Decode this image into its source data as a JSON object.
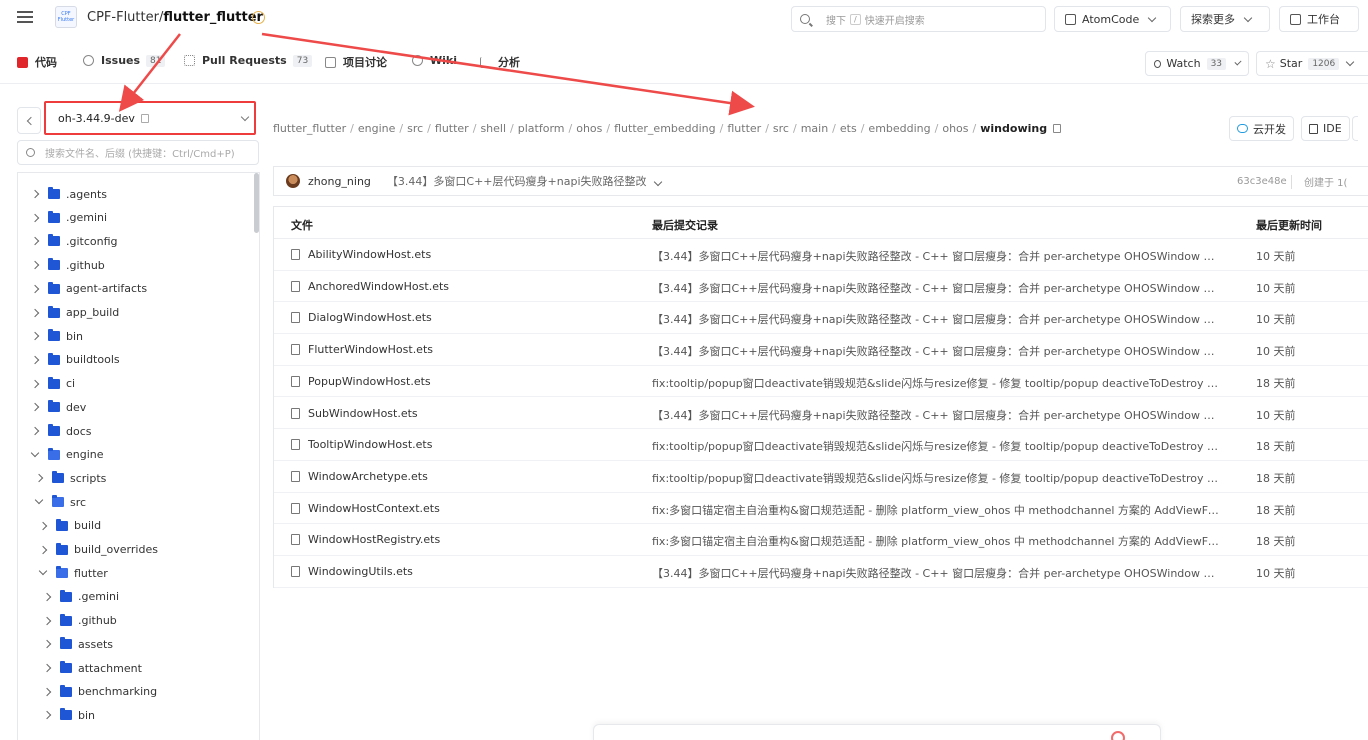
{
  "header": {
    "repo_owner": "CPF-Flutter/",
    "repo_name": "flutter_flutter",
    "logo_text": "CPF Flutter",
    "search": {
      "placeholder_prefix": "搜下",
      "shortcut": "/",
      "placeholder_suffix": "快速开启搜索"
    },
    "atomcode_label": "AtomCode",
    "explore_label": "探索更多",
    "workbench_label": "工作台"
  },
  "tabs": {
    "code": "代码",
    "issues": "Issues",
    "issues_count": "81",
    "pull_requests": "Pull Requests",
    "pull_requests_count": "73",
    "discussion": "项目讨论",
    "wiki": "Wiki",
    "analysis": "分析",
    "watch": "Watch",
    "watch_count": "33",
    "star": "Star",
    "star_count": "1206"
  },
  "sidebar": {
    "branch": "oh-3.44.9-dev",
    "file_search_placeholder": "搜索文件名、后缀 (快捷键：Ctrl/Cmd+P)",
    "tree": [
      {
        "label": ".agents",
        "level": 0,
        "open": false
      },
      {
        "label": ".gemini",
        "level": 0,
        "open": false
      },
      {
        "label": ".gitconfig",
        "level": 0,
        "open": false
      },
      {
        "label": ".github",
        "level": 0,
        "open": false
      },
      {
        "label": "agent-artifacts",
        "level": 0,
        "open": false
      },
      {
        "label": "app_build",
        "level": 0,
        "open": false
      },
      {
        "label": "bin",
        "level": 0,
        "open": false
      },
      {
        "label": "buildtools",
        "level": 0,
        "open": false
      },
      {
        "label": "ci",
        "level": 0,
        "open": false
      },
      {
        "label": "dev",
        "level": 0,
        "open": false
      },
      {
        "label": "docs",
        "level": 0,
        "open": false
      },
      {
        "label": "engine",
        "level": 0,
        "open": true
      },
      {
        "label": "scripts",
        "level": 1,
        "open": false
      },
      {
        "label": "src",
        "level": 1,
        "open": true
      },
      {
        "label": "build",
        "level": 2,
        "open": false
      },
      {
        "label": "build_overrides",
        "level": 2,
        "open": false
      },
      {
        "label": "flutter",
        "level": 2,
        "open": true
      },
      {
        "label": ".gemini",
        "level": 3,
        "open": false
      },
      {
        "label": ".github",
        "level": 3,
        "open": false
      },
      {
        "label": "assets",
        "level": 3,
        "open": false
      },
      {
        "label": "attachment",
        "level": 3,
        "open": false
      },
      {
        "label": "benchmarking",
        "level": 3,
        "open": false
      },
      {
        "label": "bin",
        "level": 3,
        "open": false
      }
    ]
  },
  "breadcrumb": {
    "segments": [
      "flutter_flutter",
      "engine",
      "src",
      "flutter",
      "shell",
      "platform",
      "ohos",
      "flutter_embedding",
      "flutter",
      "src",
      "main",
      "ets",
      "embedding",
      "ohos"
    ],
    "current": "windowing"
  },
  "actions": {
    "cloud_dev": "云开发",
    "ide": "IDE"
  },
  "last_commit": {
    "author": "zhong_ning",
    "message": "【3.44】多窗口C++层代码瘦身+napi失败路径整改",
    "hash": "63c3e48e",
    "created_label": "创建于 1("
  },
  "table": {
    "col_file": "文件",
    "col_commit": "最后提交记录",
    "col_time": "最后更新时间",
    "rows": [
      {
        "name": "AbilityWindowHost.ets",
        "msg": "【3.44】多窗口C++层代码瘦身+napi失败路径整改 - C++ 窗口层瘦身：合并 per-archetype OHOSWindow 子类（anc…",
        "time": "10 天前"
      },
      {
        "name": "AnchoredWindowHost.ets",
        "msg": "【3.44】多窗口C++层代码瘦身+napi失败路径整改 - C++ 窗口层瘦身：合并 per-archetype OHOSWindow 子类（anc…",
        "time": "10 天前"
      },
      {
        "name": "DialogWindowHost.ets",
        "msg": "【3.44】多窗口C++层代码瘦身+napi失败路径整改 - C++ 窗口层瘦身：合并 per-archetype OHOSWindow 子类（anc…",
        "time": "10 天前"
      },
      {
        "name": "FlutterWindowHost.ets",
        "msg": "【3.44】多窗口C++层代码瘦身+napi失败路径整改 - C++ 窗口层瘦身：合并 per-archetype OHOSWindow 子类（anc…",
        "time": "10 天前"
      },
      {
        "name": "PopupWindowHost.ets",
        "msg": "fix:tooltip/popup窗口deactivate销毁规范&slide闪烁与resize修复 - 修复 tooltip/popup deactiveToDestroy 规范：…",
        "time": "18 天前"
      },
      {
        "name": "SubWindowHost.ets",
        "msg": "【3.44】多窗口C++层代码瘦身+napi失败路径整改 - C++ 窗口层瘦身：合并 per-archetype OHOSWindow 子类（anc…",
        "time": "10 天前"
      },
      {
        "name": "TooltipWindowHost.ets",
        "msg": "fix:tooltip/popup窗口deactivate销毁规范&slide闪烁与resize修复 - 修复 tooltip/popup deactiveToDestroy 规范：…",
        "time": "18 天前"
      },
      {
        "name": "WindowArchetype.ets",
        "msg": "fix:tooltip/popup窗口deactivate销毁规范&slide闪烁与resize修复 - 修复 tooltip/popup deactiveToDestroy 规范：…",
        "time": "18 天前"
      },
      {
        "name": "WindowHostContext.ets",
        "msg": "fix:多窗口锚定宿主自治重构&窗口规范适配 - 删除 platform_view_ohos 中 methodchannel 方案的 AddViewForWin…",
        "time": "18 天前"
      },
      {
        "name": "WindowHostRegistry.ets",
        "msg": "fix:多窗口锚定宿主自治重构&窗口规范适配 - 删除 platform_view_ohos 中 methodchannel 方案的 AddViewForWin…",
        "time": "18 天前"
      },
      {
        "name": "WindowingUtils.ets",
        "msg": "【3.44】多窗口C++层代码瘦身+napi失败路径整改 - C++ 窗口层瘦身：合并 per-archetype OHOSWindow 子类（anc…",
        "time": "10 天前"
      }
    ]
  },
  "colors": {
    "annotation_red": "#ee3b3b",
    "folder_blue": "#1f56d6",
    "active_tab_red": "#e0262a"
  }
}
